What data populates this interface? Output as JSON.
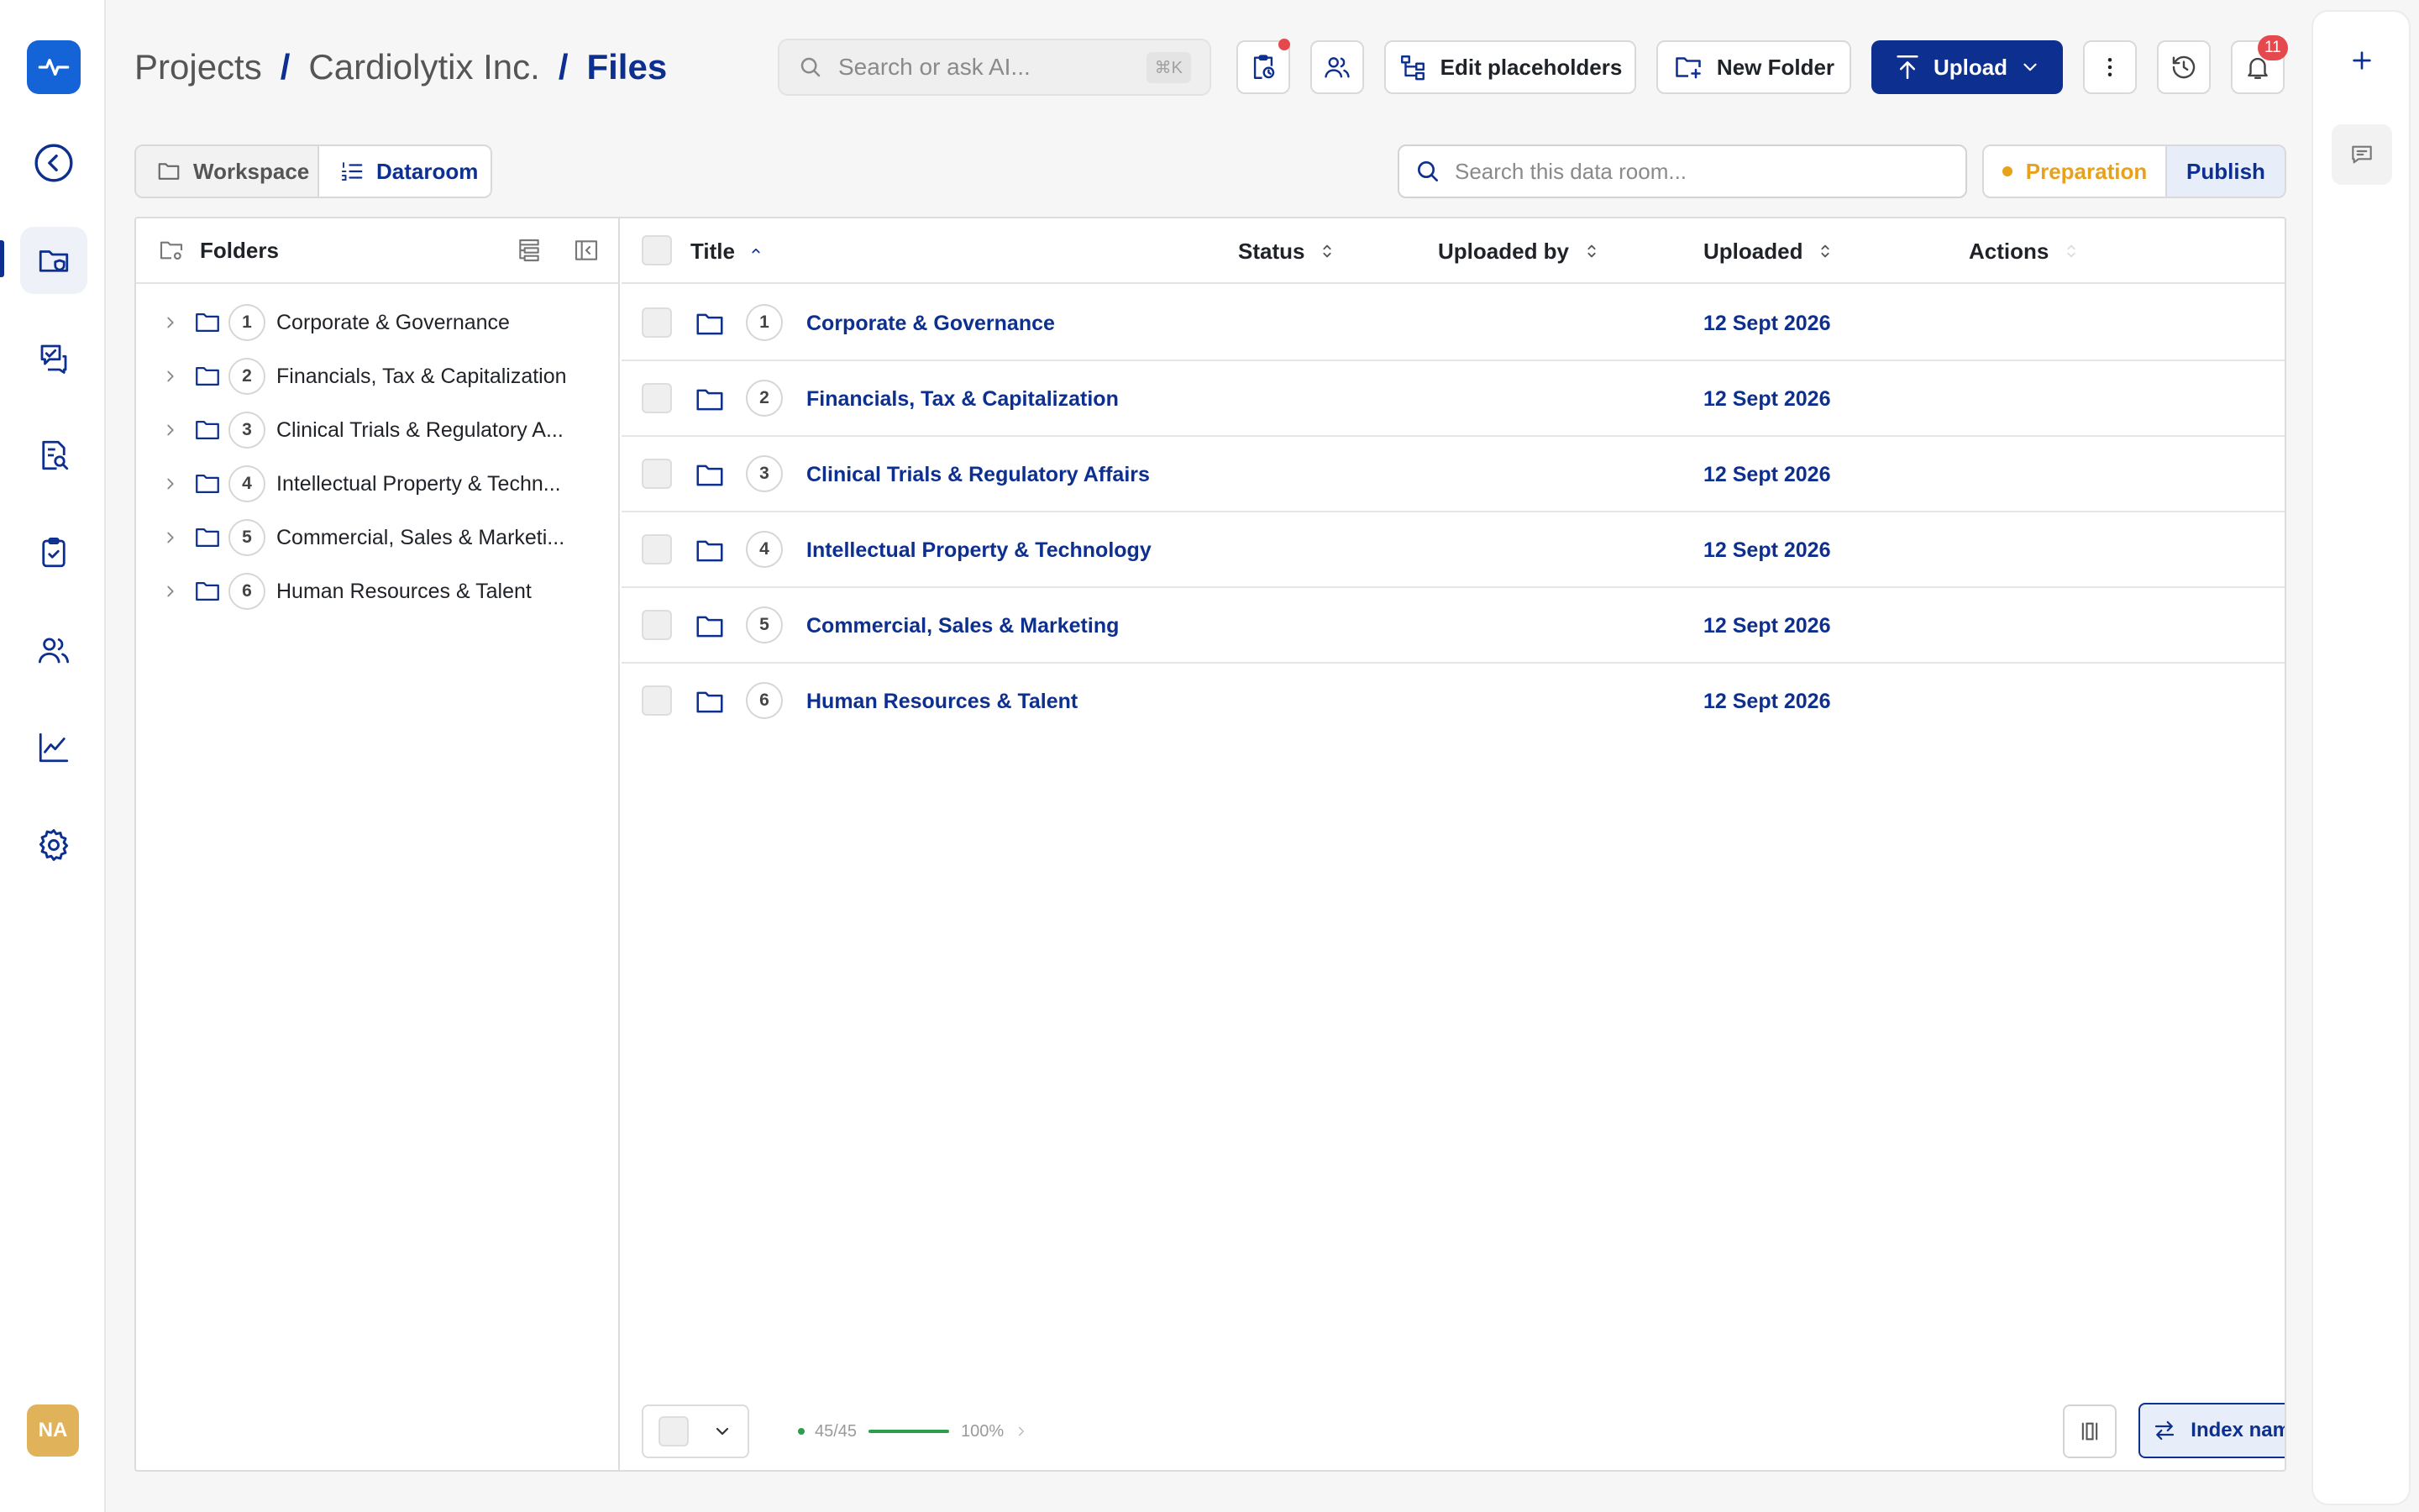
{
  "breadcrumb": {
    "items": [
      "Projects",
      "Cardiolytix Inc."
    ],
    "current": "Files",
    "separator": "/"
  },
  "search": {
    "placeholder": "Search or ask AI...",
    "shortcut": "⌘K"
  },
  "header": {
    "edit_placeholders": "Edit placeholders",
    "new_folder": "New Folder",
    "upload": "Upload",
    "notifications_count": "11"
  },
  "view_toggle": {
    "workspace": "Workspace",
    "dataroom": "Dataroom",
    "active": "Dataroom"
  },
  "room_search": {
    "placeholder": "Search this data room..."
  },
  "mode": {
    "preparation": "Preparation",
    "publish": "Publish"
  },
  "tree": {
    "title": "Folders",
    "items": [
      {
        "num": "1",
        "label": "Corporate & Governance"
      },
      {
        "num": "2",
        "label": "Financials, Tax & Capitalization"
      },
      {
        "num": "3",
        "label": "Clinical Trials & Regulatory A..."
      },
      {
        "num": "4",
        "label": "Intellectual Property & Techn..."
      },
      {
        "num": "5",
        "label": "Commercial, Sales & Marketi..."
      },
      {
        "num": "6",
        "label": "Human Resources & Talent"
      }
    ]
  },
  "table": {
    "columns": {
      "title": "Title",
      "status": "Status",
      "uploaded_by": "Uploaded by",
      "uploaded": "Uploaded",
      "actions": "Actions"
    },
    "rows": [
      {
        "num": "1",
        "title": "Corporate & Governance",
        "uploaded": "12 Sept 2026"
      },
      {
        "num": "2",
        "title": "Financials, Tax & Capitalization",
        "uploaded": "12 Sept 2026"
      },
      {
        "num": "3",
        "title": "Clinical Trials & Regulatory Affairs",
        "uploaded": "12 Sept 2026"
      },
      {
        "num": "4",
        "title": "Intellectual Property & Technology",
        "uploaded": "12 Sept 2026"
      },
      {
        "num": "5",
        "title": "Commercial, Sales & Marketing",
        "uploaded": "12 Sept 2026"
      },
      {
        "num": "6",
        "title": "Human Resources & Talent",
        "uploaded": "12 Sept 2026"
      }
    ]
  },
  "footer": {
    "progress_count": "45/45",
    "progress_percent": "100%",
    "progress_value": 1.0,
    "index_names": "Index names"
  },
  "user": {
    "initials": "NA"
  },
  "colors": {
    "accent": "#0d2f8f",
    "logo": "#1464d8",
    "preparation": "#e8a11a",
    "notification": "#e5484d",
    "progress": "#2e9e4e",
    "avatar": "#e0b35b"
  }
}
